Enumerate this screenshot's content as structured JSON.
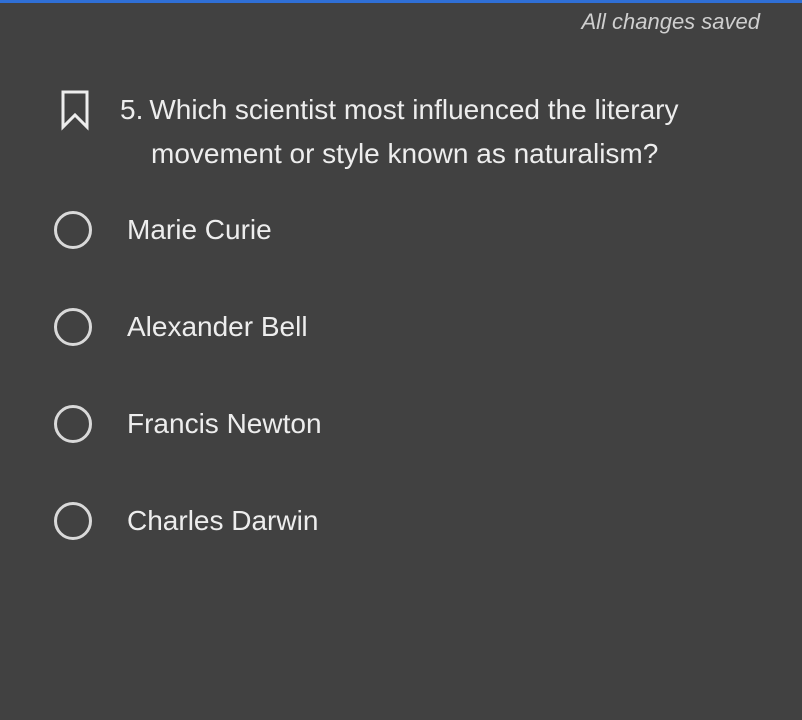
{
  "status": {
    "save_text": "All changes saved"
  },
  "question": {
    "number": "5.",
    "line1": "Which scientist most influenced the literary",
    "line2": "movement or style known as naturalism?",
    "bookmark_icon": "bookmark-outline-icon"
  },
  "options": [
    {
      "label": "Marie Curie",
      "selected": false
    },
    {
      "label": "Alexander Bell",
      "selected": false
    },
    {
      "label": "Francis Newton",
      "selected": false
    },
    {
      "label": "Charles Darwin",
      "selected": false
    }
  ],
  "colors": {
    "background": "#414141",
    "text": "#ededed",
    "status_text": "#cfcfcf",
    "radio_border": "#d9d9d9",
    "accent": "#2f6fd6"
  }
}
